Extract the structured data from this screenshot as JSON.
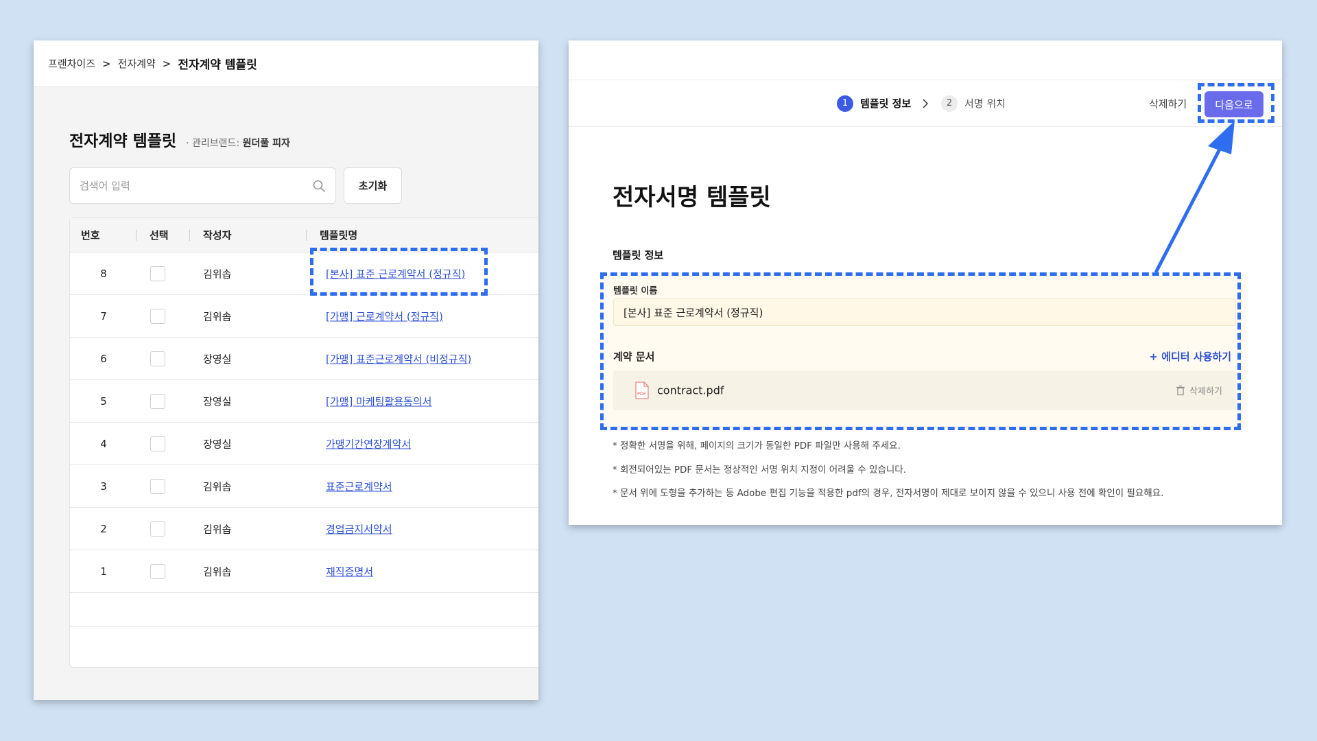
{
  "left": {
    "breadcrumb": [
      "프랜차이즈",
      "전자계약",
      "전자계약 템플릿"
    ],
    "breadcrumb_sep": ">",
    "title": "전자계약 템플릿",
    "brand_prefix": "· 관리브랜드: ",
    "brand_name": "원더풀 피자",
    "search_placeholder": "검색어 입력",
    "reset_label": "초기화",
    "columns": [
      "번호",
      "선택",
      "작성자",
      "템플릿명"
    ],
    "rows": [
      {
        "num": "8",
        "author": "김위솝",
        "name": "[본사] 표준 근로계약서 (정규직)"
      },
      {
        "num": "7",
        "author": "김위솝",
        "name": "[가맹] 근로계약서 (정규직)"
      },
      {
        "num": "6",
        "author": "장영실",
        "name": "[가맹] 표준근로계약서 (비정규직)"
      },
      {
        "num": "5",
        "author": "장영실",
        "name": "[가맹] 마케팅활용동의서"
      },
      {
        "num": "4",
        "author": "장영실",
        "name": "가맹기간연장계약서"
      },
      {
        "num": "3",
        "author": "김위솝",
        "name": "표준근로계약서"
      },
      {
        "num": "2",
        "author": "김위솝",
        "name": "경업금지서약서"
      },
      {
        "num": "1",
        "author": "김위솝",
        "name": "재직증명서"
      }
    ]
  },
  "right": {
    "steps": [
      {
        "num": "1",
        "label": "템플릿 정보"
      },
      {
        "num": "2",
        "label": "서명 위치"
      }
    ],
    "delete_label": "삭제하기",
    "next_label": "다음으로",
    "title": "전자서명 템플릿",
    "section_label": "템플릿 정보",
    "field_label": "템플릿 이름",
    "field_value": "[본사] 표준 근로계약서 (정규직)",
    "doc_label": "계약 문서",
    "editor_link": "+ 에디터 사용하기",
    "file_name": "contract.pdf",
    "file_delete": "삭제하기",
    "notes": [
      "* 정확한 서명을 위해, 페이지의 크기가 동일한 PDF 파일만 사용해 주세요.",
      "* 회전되어있는 PDF 문서는 정상적인 서명 위치 지정이 어려울 수 있습니다.",
      "* 문서 위에 도형을 추가하는 등 Adobe 편집 기능을 적용한 pdf의 경우, 전자서명이 제대로 보이지 않을 수 있으니 사용 전에 확인이 필요해요."
    ]
  },
  "colors": {
    "background": "#cfe1f3",
    "accent": "#3b5be6",
    "next_button": "#6a6bea",
    "link": "#2b4fd6",
    "annotation": "#2f6df0",
    "form_highlight": "#fffbf0"
  }
}
